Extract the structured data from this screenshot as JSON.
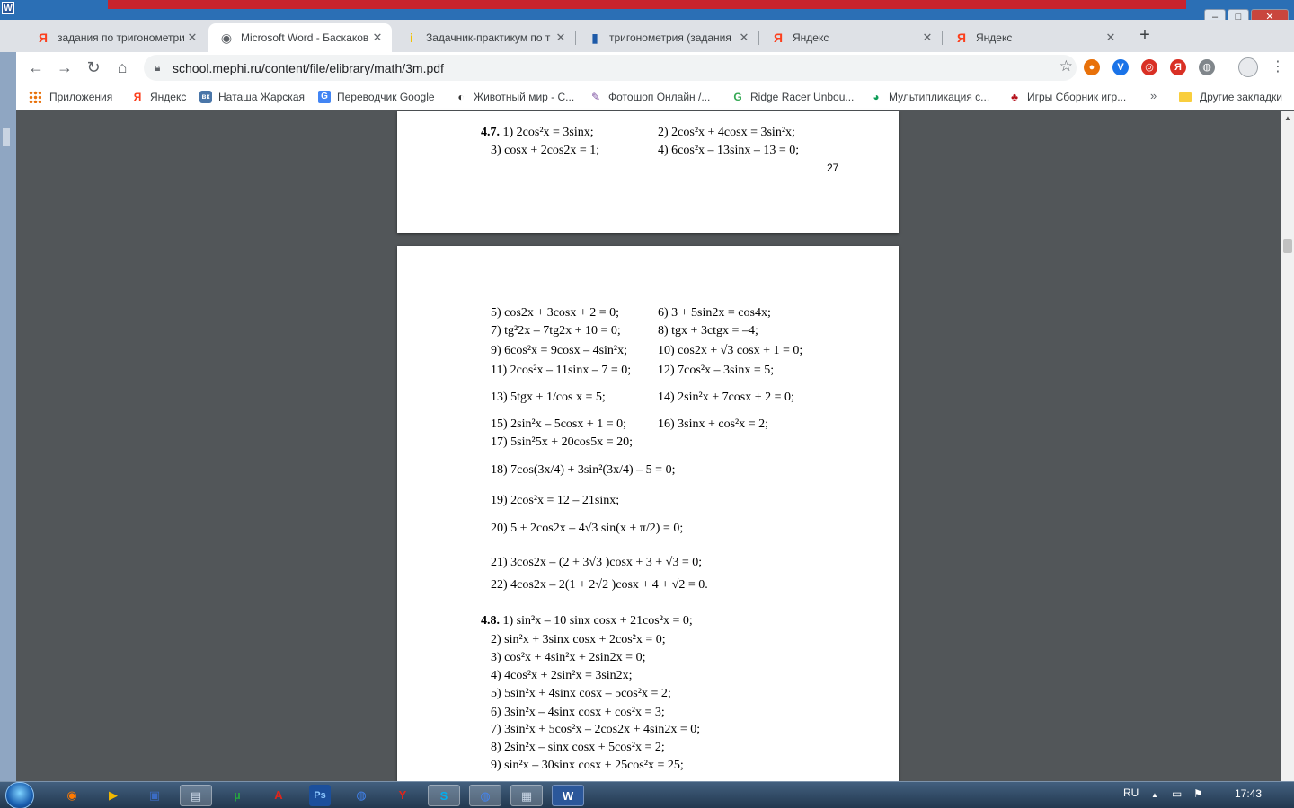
{
  "window": {
    "app_logo": "W",
    "minimize_glyph": "–",
    "maximize_glyph": "□",
    "close_glyph": "✕"
  },
  "tabs": [
    {
      "title": "задания по тригонометрии",
      "favicon": "Я",
      "favicon_color": "#fc3f1d",
      "active": false
    },
    {
      "title": "Microsoft Word - Баскаков",
      "favicon": "◉",
      "favicon_color": "#5f6368",
      "active": true
    },
    {
      "title": "Задачник-практикум по т",
      "favicon": "i",
      "favicon_color": "#f2c200",
      "active": false
    },
    {
      "title": "тригонометрия (задания",
      "favicon": "▮",
      "favicon_color": "#1e5aa8",
      "active": false
    },
    {
      "title": "Яндекс",
      "favicon": "Я",
      "favicon_color": "#fc3f1d",
      "active": false
    },
    {
      "title": "Яндекс",
      "favicon": "Я",
      "favicon_color": "#fc3f1d",
      "active": false
    }
  ],
  "tab_close_glyph": "✕",
  "new_tab_glyph": "+",
  "toolbar": {
    "back_glyph": "←",
    "forward_glyph": "→",
    "reload_glyph": "↻",
    "home_glyph": "⌂",
    "url": "school.mephi.ru/content/file/elibrary/math/3m.pdf",
    "star_glyph": "☆",
    "menu_glyph": "⋮",
    "extensions": [
      {
        "glyph": "●",
        "color": "#e8710a"
      },
      {
        "glyph": "V",
        "color": "#1a73e8"
      },
      {
        "glyph": "◎",
        "color": "#d93025"
      },
      {
        "glyph": "Я",
        "color": "#d93025"
      },
      {
        "glyph": "◍",
        "color": "#80868b"
      }
    ]
  },
  "bookmarks": [
    {
      "label": "Приложения",
      "icon": "grid"
    },
    {
      "label": "Яндекс",
      "icon": "Я",
      "color": "#fc3f1d"
    },
    {
      "label": "Наташа Жарская",
      "icon": "вк",
      "color": "#4a76a8"
    },
    {
      "label": "Переводчик Google",
      "icon": "G",
      "color": "#4285f4"
    },
    {
      "label": "Животный мир - С...",
      "icon": "◐",
      "color": "#333333"
    },
    {
      "label": "Фотошоп Онлайн /...",
      "icon": "✎",
      "color": "#7b4fa0"
    },
    {
      "label": "Ridge Racer Unbou...",
      "icon": "G",
      "color": "#34a853"
    },
    {
      "label": "Мультипликация с...",
      "icon": "◕",
      "color": "#0f9d58"
    },
    {
      "label": "Игры Сборник игр...",
      "icon": "♣",
      "color": "#b5121b"
    }
  ],
  "bookmarks_more": "»",
  "bookmarks_other": "Другие закладки",
  "pdf": {
    "page1": {
      "number": "4.7.",
      "lines": [
        {
          "left": "1) 2cos²x = 3sinx;",
          "right": "2) 2cos²x + 4cosx = 3sin²x;"
        },
        {
          "left": "3) cosx + 2cos2x = 1;",
          "right": "4) 6cos²x – 13sinx – 13 = 0;"
        }
      ],
      "page_number": "27"
    },
    "page2_pairs": [
      {
        "left": "5) cos2x + 3cosx + 2 = 0;",
        "right": "6)  3 + 5sin2x = cos4x;"
      },
      {
        "left": "7) tg²2x – 7tg2x + 10 = 0;",
        "right": "8) tgx + 3ctgx = –4;"
      },
      {
        "left": "9) 6cos²x = 9cosx –  4sin²x;",
        "right": "10) cos2x + √3 cosx + 1 = 0;"
      },
      {
        "left": "11) 2cos²x – 11sinx – 7 = 0;",
        "right": "12) 7cos²x – 3sinx = 5;"
      },
      {
        "left": "13) 5tgx + 1/cos x = 5;",
        "right": "14) 2sin²x + 7cosx + 2 = 0;"
      },
      {
        "left": "15) 2sin²x – 5cosx + 1 = 0;",
        "right": "16) 3sinx + cos²x = 2;"
      }
    ],
    "page2_singles": [
      "17) 5sin²5x + 20cos5x = 20;",
      "18)  7cos(3x/4) + 3sin²(3x/4) – 5 = 0;",
      "19) 2cos²x = 12 – 21sinx;",
      "20) 5 + 2cos2x – 4√3 sin(x + π/2) = 0;",
      "21) 3cos2x – (2 + 3√3 )cosx + 3 + √3  = 0;",
      "22) 4cos2x – 2(1 + 2√2 )cosx + 4 + √2 = 0."
    ],
    "section_48": {
      "number": "4.8.",
      "lines": [
        "1) sin²x – 10 sinx cosx + 21cos²x = 0;",
        "2) sin²x + 3sinx cosx + 2cos²x = 0;",
        "3) cos²x + 4sin²x + 2sin2x = 0;",
        "4) 4cos²x + 2sin²x = 3sin2x;",
        "5) 5sin²x + 4sinx cosx – 5cos²x = 2;",
        "6) 3sin²x – 4sinx cosx + cos²x = 3;",
        "7) 3sin²x + 5cos²x – 2cos2x + 4sin2x = 0;",
        "8) 2sin²x – sinx cosx + 5cos²x = 2;",
        "9) sin²x – 30sinx cosx + 25cos²x = 25;"
      ]
    }
  },
  "taskbar": {
    "items": [
      {
        "glyph": "◉",
        "color": "#ff7a00"
      },
      {
        "glyph": "▶",
        "color": "#f3b800"
      },
      {
        "glyph": "▣",
        "color": "#3b6cc4"
      },
      {
        "glyph": "▤",
        "color": "#c9d6e6"
      },
      {
        "glyph": "µ",
        "color": "#26a640"
      },
      {
        "glyph": "A",
        "color": "#e0251b"
      },
      {
        "glyph": "Ps",
        "color": "#1b4f9c"
      },
      {
        "glyph": "◍",
        "color": "#4285f4"
      },
      {
        "glyph": "Y",
        "color": "#e0251b"
      },
      {
        "glyph": "S",
        "color": "#00aff0"
      },
      {
        "glyph": "◍",
        "color": "#4285f4"
      },
      {
        "glyph": "▦",
        "color": "#c9d6e6"
      },
      {
        "glyph": "W",
        "color": "#2b579a"
      }
    ],
    "lang": "RU",
    "tray_up": "▲",
    "time": "17:43"
  }
}
